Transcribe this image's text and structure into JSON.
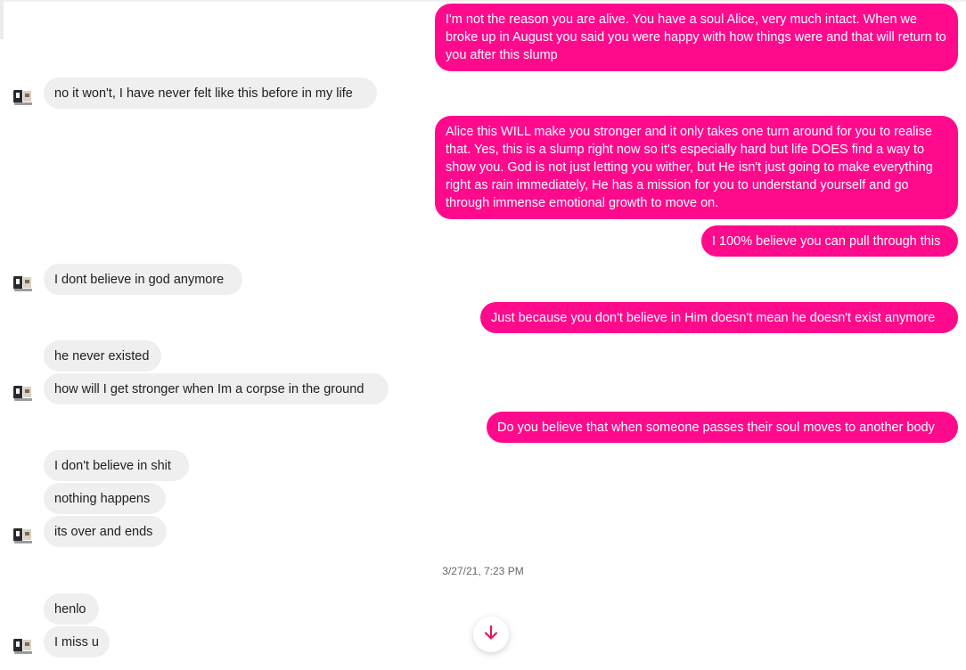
{
  "conversation": {
    "messages": [
      {
        "side": "out",
        "text": "I'm not the reason you are alive. You have a soul Alice, very much intact. When we broke up in August you said you were happy with how things were and that will return to you after this slump"
      },
      {
        "side": "in",
        "text": "no it won't, I have never felt like this before in my life"
      },
      {
        "side": "out",
        "text": "Alice this WILL make you stronger and it only takes one turn around for you to realise that. Yes, this is a slump right now so it's especially hard but life DOES find a way to show you. God is not just letting you wither, but He isn't just going to make everything right as rain immediately, He has a mission for you to understand yourself and go through immense emotional growth to move on."
      },
      {
        "side": "out",
        "text": "I 100% believe you can pull through this"
      },
      {
        "side": "in",
        "text": "I dont believe in god anymore"
      },
      {
        "side": "out",
        "text": "Just because you don't believe in Him doesn't mean he doesn't exist anymore"
      },
      {
        "side": "in",
        "text": "he never existed"
      },
      {
        "side": "in",
        "text": "how will I get stronger when Im a corpse in the ground"
      },
      {
        "side": "out",
        "text": "Do you believe that when someone passes their soul moves to another body"
      },
      {
        "side": "in",
        "text": "I don't believe in shit"
      },
      {
        "side": "in",
        "text": "nothing happens"
      },
      {
        "side": "in",
        "text": "its over and ends"
      },
      {
        "side": "in",
        "text": "henlo"
      },
      {
        "side": "in",
        "text": "I miss u"
      }
    ],
    "timestamp": "3/27/21, 7:23 PM"
  },
  "icons": {
    "avatar": "contact-avatar-icon",
    "scroll_down": "arrow-down-icon"
  },
  "colors": {
    "outgoing_bubble": "#ff0a8c",
    "incoming_bubble": "#efefef",
    "scroll_arrow": "#e8175d"
  }
}
